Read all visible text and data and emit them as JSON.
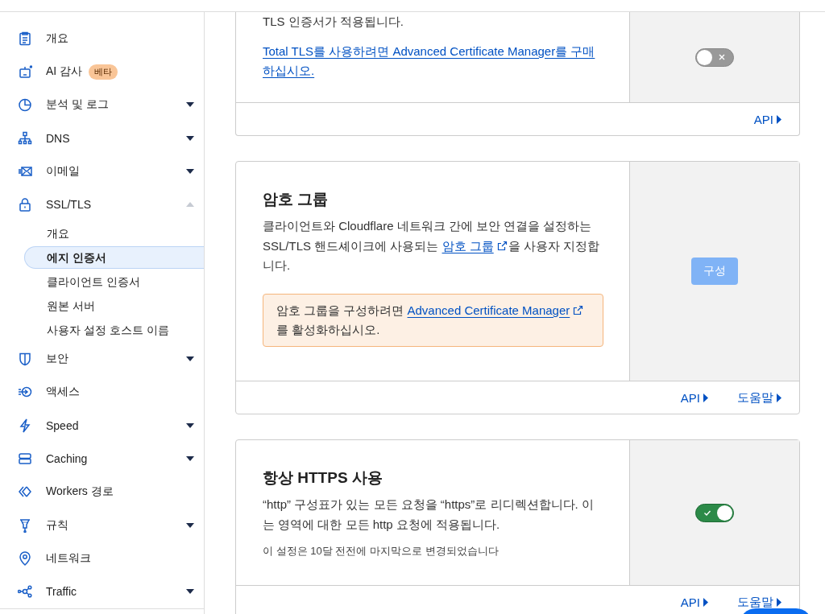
{
  "sidebar": {
    "items": [
      {
        "label": "개요"
      },
      {
        "label": "AI 감사",
        "badge": "베타"
      },
      {
        "label": "분석 및 로그",
        "expanded": false
      },
      {
        "label": "DNS",
        "expanded": false
      },
      {
        "label": "이메일",
        "expanded": false
      },
      {
        "label": "SSL/TLS",
        "expanded": true,
        "children": [
          {
            "label": "개요",
            "selected": false
          },
          {
            "label": "에지 인증서",
            "selected": true
          },
          {
            "label": "클라이언트 인증서",
            "selected": false
          },
          {
            "label": "원본 서버",
            "selected": false
          },
          {
            "label": "사용자 설정 호스트 이름",
            "selected": false
          }
        ]
      },
      {
        "label": "보안",
        "expanded": false
      },
      {
        "label": "액세스"
      },
      {
        "label": "Speed",
        "expanded": false
      },
      {
        "label": "Caching",
        "expanded": false
      },
      {
        "label": "Workers 경로"
      },
      {
        "label": "규칙",
        "expanded": false
      },
      {
        "label": "네트워크"
      },
      {
        "label": "Traffic",
        "expanded": false
      }
    ]
  },
  "cards": [
    {
      "paragraphs": [
        {
          "parts": [
            {
              "text": "TLS 인증서가 적용됩니다."
            }
          ]
        },
        {
          "parts": [
            {
              "link": "Total TLS를 사용하려면 Advanced Certificate Manager를 구매하십시오."
            }
          ]
        }
      ],
      "control": {
        "kind": "toggle",
        "on": false
      },
      "footer_links": [
        "API"
      ]
    },
    {
      "title": "암호 그룹",
      "paragraphs": [
        {
          "parts": [
            {
              "text": "클라이언트와 Cloudflare 네트워크 간에 보안 연결을 설정하는 SSL/TLS 핸드셰이크에 사용되는 "
            },
            {
              "link": "암호 그룹",
              "external": true
            },
            {
              "text": "을 사용자 지정합니다."
            }
          ]
        }
      ],
      "notice": {
        "parts": [
          {
            "text": "암호 그룹을 구성하려면 "
          },
          {
            "link": "Advanced Certificate Manager",
            "external": true
          },
          {
            "text": "를 활성화하십시오."
          }
        ]
      },
      "control": {
        "kind": "button",
        "label": "구성",
        "disabled": true
      },
      "footer_links": [
        "API",
        "도움말"
      ]
    },
    {
      "title": "항상 HTTPS 사용",
      "paragraphs": [
        {
          "parts": [
            {
              "text": "“http” 구성표가 있는 모든 요청을 “https”로 리디렉션합니다. 이는 영역에 대한 모든 http 요청에 적용됩니다."
            }
          ]
        }
      ],
      "note": "이 설정은 10달 전전에 마지막으로 변경되었습니다",
      "control": {
        "kind": "toggle",
        "on": true
      },
      "footer_links": [
        "API",
        "도움말"
      ]
    }
  ]
}
